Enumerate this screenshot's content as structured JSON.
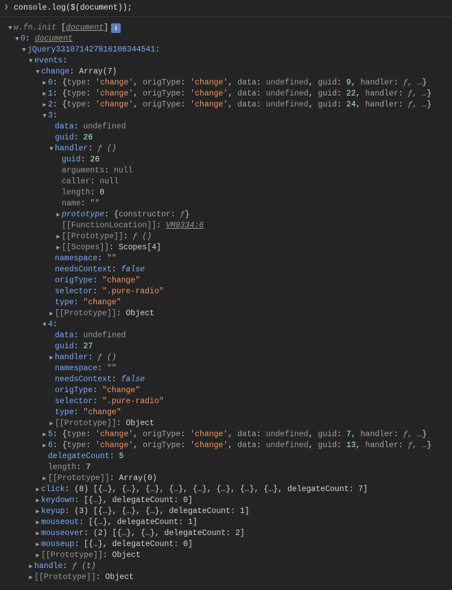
{
  "input": {
    "prompt_caret": "❯",
    "code": "console.log($(document));"
  },
  "root": {
    "constructor": "w.fn.init",
    "arg_link": "document",
    "info_icon": "i"
  },
  "idx0": {
    "key": "0",
    "value_link": "document"
  },
  "jq": {
    "key": "jQuery331071427816106344541"
  },
  "events": {
    "key": "events"
  },
  "change": {
    "key": "change",
    "value_desc": "Array(7)"
  },
  "ch": {
    "e0": {
      "idx": "0",
      "type": "'change'",
      "origType": "'change'",
      "data": "undefined",
      "guid": "9"
    },
    "e1": {
      "idx": "1",
      "type": "'change'",
      "origType": "'change'",
      "data": "undefined",
      "guid": "22"
    },
    "e2": {
      "idx": "2",
      "type": "'change'",
      "origType": "'change'",
      "data": "undefined",
      "guid": "24"
    },
    "e3": {
      "idx": "3",
      "data": "undefined",
      "guid": "26",
      "handler_sig": "ƒ ()",
      "h_guid": "26",
      "h_arguments": "null",
      "h_caller": "null",
      "h_length": "0",
      "h_name": "\"\"",
      "h_proto_desc": "{constructor: ƒ}",
      "h_func_loc": "VM9334:6",
      "h_proto2": "ƒ ()",
      "h_scopes": "Scopes[4]",
      "namespace": "\"\"",
      "needsContext": "false",
      "origType": "\"change\"",
      "selector": "\".pure-radio\"",
      "type_v": "\"change\"",
      "proto": "Object"
    },
    "e4": {
      "idx": "4",
      "data": "undefined",
      "guid": "27",
      "handler_sig": "ƒ ()",
      "namespace": "\"\"",
      "needsContext": "false",
      "origType": "\"change\"",
      "selector": "\".pure-radio\"",
      "type_v": "\"change\"",
      "proto": "Object"
    },
    "e5": {
      "idx": "5",
      "type": "'change'",
      "origType": "'change'",
      "data": "undefined",
      "guid": "7"
    },
    "e6": {
      "idx": "6",
      "type": "'change'",
      "origType": "'change'",
      "data": "undefined",
      "guid": "13"
    },
    "delegateCount": "5",
    "length": "7",
    "proto": "Array(0)"
  },
  "evts": {
    "click": {
      "key": "click",
      "preview": "(8) [{…}, {…}, {…}, {…}, {…}, {…}, {…}, {…}, delegateCount: 7]"
    },
    "keydown": {
      "key": "keydown",
      "preview": "[{…}, delegateCount: 0]"
    },
    "keyup": {
      "key": "keyup",
      "preview": "(3) [{…}, {…}, {…}, delegateCount: 1]"
    },
    "mouseout": {
      "key": "mouseout",
      "preview": "[{…}, delegateCount: 1]"
    },
    "mouseover": {
      "key": "mouseover",
      "preview": "(2) [{…}, {…}, delegateCount: 2]"
    },
    "mouseup": {
      "key": "mouseup",
      "preview": "[{…}, delegateCount: 0]"
    },
    "proto": "Object"
  },
  "handle": {
    "key": "handle",
    "value": "ƒ (t)"
  },
  "proto": "Object",
  "labels": {
    "type": "type",
    "origType": "origType",
    "data": "data",
    "guid": "guid",
    "handler": "handler",
    "arguments": "arguments",
    "caller": "caller",
    "length": "length",
    "name": "name",
    "prototype": "prototype",
    "FunctionLocation": "[[FunctionLocation]]",
    "Prototype": "[[Prototype]]",
    "Scopes": "[[Scopes]]",
    "namespace": "namespace",
    "needsContext": "needsContext",
    "selector": "selector",
    "delegateCount": "delegateCount",
    "constructor": "constructor",
    "fnsym": "ƒ",
    "ellipsis": "…",
    "f_ellipsis": "ƒ, …"
  }
}
